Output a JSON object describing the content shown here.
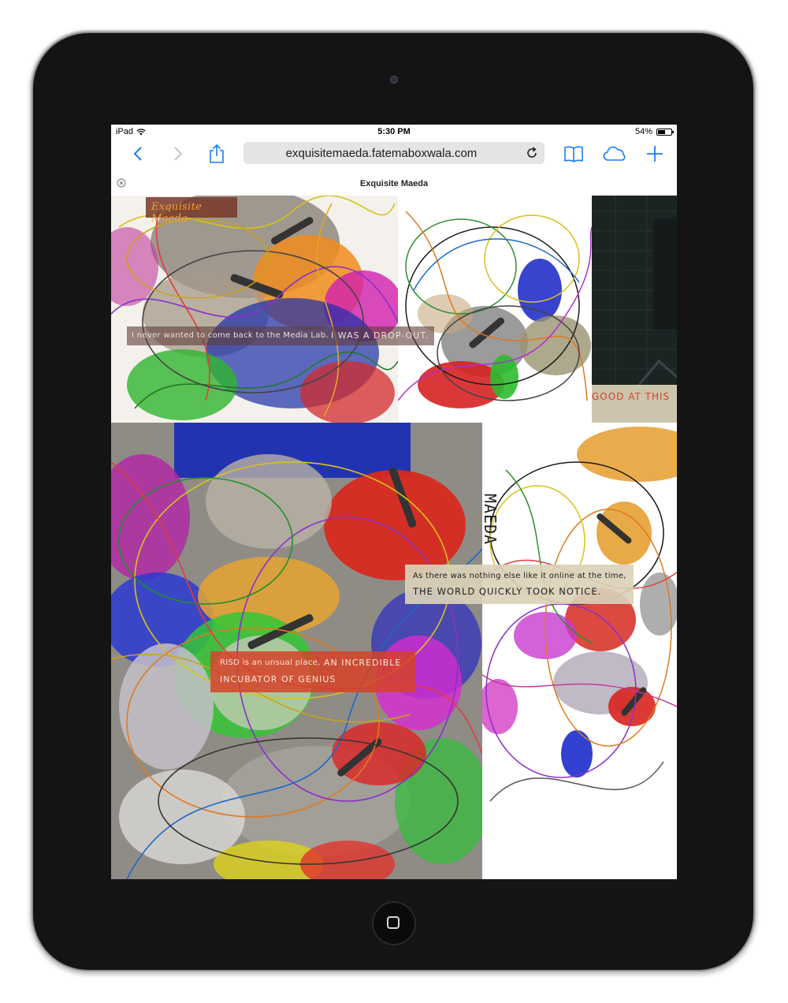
{
  "status": {
    "carrier": "iPad",
    "time": "5:30 PM",
    "battery_label": "54%",
    "battery_level": 0.54
  },
  "browser": {
    "url": "exquisitemaeda.fatemaboxwala.com",
    "tab_title": "Exquisite Maeda",
    "icons": [
      "back-icon",
      "forward-icon",
      "share-icon",
      "reload-icon",
      "bookmarks-icon",
      "icloud-tabs-icon",
      "new-tab-icon",
      "tab-close-icon"
    ]
  },
  "page": {
    "logo": "Exquisite Maeda",
    "quote1": {
      "text": "I never wanted to come back to the Media Lab.",
      "emphasis": "I WAS A DROP-OUT."
    },
    "quote2": {
      "emphasis": "GOOD AT THIS"
    },
    "quote3": {
      "text": "As there was nothing else like it online at the time,",
      "emphasis": "THE WORLD QUICKLY TOOK NOTICE."
    },
    "quote4": {
      "text": "RISD is an unsual place,",
      "emphasis_line1": "AN INCREDIBLE",
      "emphasis_line2": "INCUBATOR OF GENIUS"
    },
    "handwriting": "MAEDA"
  },
  "colors": {
    "device_bezel": "#141414",
    "accent_blue": "#1a7cf5",
    "caption_dark": "rgba(60,40,35,0.72)",
    "caption_light": "rgba(214,205,180,0.9)",
    "caption_red": "rgba(214,66,40,0.85)",
    "logo_bg": "rgba(120,55,40,0.85)",
    "logo_text": "#f2a030"
  }
}
